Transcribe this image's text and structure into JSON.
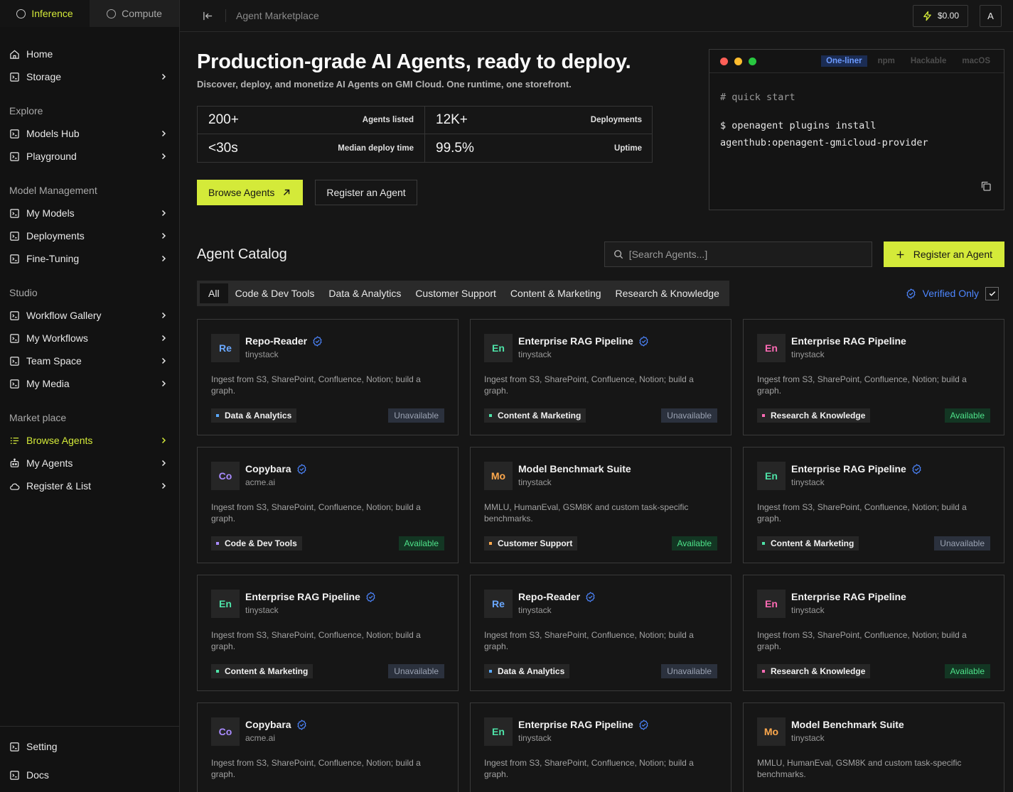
{
  "sidebar": {
    "mode_tabs": [
      {
        "label": "Inference",
        "active": true
      },
      {
        "label": "Compute",
        "active": false
      }
    ],
    "top_items": [
      {
        "label": "Home",
        "icon": "home-icon",
        "chevron": false
      },
      {
        "label": "Storage",
        "icon": "storage-icon",
        "chevron": true
      }
    ],
    "sections": [
      {
        "title": "Explore",
        "items": [
          {
            "label": "Models Hub",
            "icon": "models-hub-icon",
            "chevron": true
          },
          {
            "label": "Playground",
            "icon": "playground-icon",
            "chevron": true
          }
        ]
      },
      {
        "title": "Model Management",
        "items": [
          {
            "label": "My Models",
            "icon": "my-models-icon",
            "chevron": true
          },
          {
            "label": "Deployments",
            "icon": "deployments-icon",
            "chevron": true
          },
          {
            "label": "Fine-Tuning",
            "icon": "fine-tuning-icon",
            "chevron": true
          }
        ]
      },
      {
        "title": "Studio",
        "items": [
          {
            "label": "Workflow Gallery",
            "icon": "workflow-gallery-icon",
            "chevron": true
          },
          {
            "label": "My Workflows",
            "icon": "my-workflows-icon",
            "chevron": true
          },
          {
            "label": "Team Space",
            "icon": "team-space-icon",
            "chevron": true
          },
          {
            "label": "My Media",
            "icon": "my-media-icon",
            "chevron": true
          }
        ]
      },
      {
        "title": "Market place",
        "items": [
          {
            "label": "Browse Agents",
            "icon": "browse-agents-icon",
            "chevron": true,
            "active": true
          },
          {
            "label": "My Agents",
            "icon": "robot-icon",
            "chevron": true
          },
          {
            "label": "Register & List",
            "icon": "cloud-icon",
            "chevron": true
          }
        ]
      }
    ],
    "bottom_items": [
      {
        "label": "Setting",
        "icon": "setting-icon"
      },
      {
        "label": "Docs",
        "icon": "docs-icon"
      }
    ]
  },
  "topbar": {
    "breadcrumb": "Agent Marketplace",
    "balance": "$0.00",
    "avatar": "A"
  },
  "hero": {
    "title": "Production-grade AI Agents, ready to deploy.",
    "subtitle": "Discover, deploy, and monetize AI Agents on GMI Cloud. One runtime, one storefront.",
    "stats": [
      {
        "value": "200+",
        "label": "Agents listed"
      },
      {
        "value": "12K+",
        "label": "Deployments"
      },
      {
        "value": "<30s",
        "label": "Median deploy time"
      },
      {
        "value": "99.5%",
        "label": "Uptime"
      }
    ],
    "browse_label": "Browse Agents",
    "register_label": "Register an Agent"
  },
  "terminal": {
    "tabs": [
      {
        "label": "One-liner",
        "active": true
      },
      {
        "label": "npm",
        "active": false
      },
      {
        "label": "Hackable",
        "active": false
      },
      {
        "label": "macOS",
        "active": false
      }
    ],
    "comment": "# quick start",
    "command_line1": "$ openagent plugins install",
    "command_line2": "agenthub:openagent-gmicloud-provider",
    "dot_colors": [
      "#ff5f57",
      "#febc2e",
      "#28c840"
    ]
  },
  "catalog": {
    "title": "Agent Catalog",
    "search_placeholder": "[Search Agents...]",
    "register_label": "Register an Agent",
    "filters": [
      {
        "label": "All",
        "active": true
      },
      {
        "label": "Code & Dev Tools",
        "active": false
      },
      {
        "label": "Data & Analytics",
        "active": false
      },
      {
        "label": "Customer Support",
        "active": false
      },
      {
        "label": "Content & Marketing",
        "active": false
      },
      {
        "label": "Research & Knowledge",
        "active": false
      }
    ],
    "verified_label": "Verified Only",
    "verified_checked": true,
    "cards": [
      {
        "abbr": "Re",
        "abbr_color": "#6aa8ff",
        "name": "Repo-Reader",
        "verified": true,
        "org": "tinystack",
        "desc": "Ingest from S3, SharePoint, Confluence, Notion; build a graph.",
        "tag": "Data & Analytics",
        "tag_color": "#5aa9ff",
        "status": "Unavailable"
      },
      {
        "abbr": "En",
        "abbr_color": "#4ee3a8",
        "name": "Enterprise RAG Pipeline",
        "verified": true,
        "org": "tinystack",
        "desc": "Ingest from S3, SharePoint, Confluence, Notion; build a graph.",
        "tag": "Content & Marketing",
        "tag_color": "#4ee3a8",
        "status": "Unavailable"
      },
      {
        "abbr": "En",
        "abbr_color": "#ff6bb5",
        "name": "Enterprise RAG Pipeline",
        "verified": false,
        "org": "tinystack",
        "desc": "Ingest from S3, SharePoint, Confluence, Notion; build a graph.",
        "tag": "Research & Knowledge",
        "tag_color": "#ff6bb5",
        "status": "Available"
      },
      {
        "abbr": "Co",
        "abbr_color": "#a98bff",
        "name": "Copybara",
        "verified": true,
        "org": "acme.ai",
        "desc": "Ingest from S3, SharePoint, Confluence, Notion; build a graph.",
        "tag": "Code & Dev Tools",
        "tag_color": "#a98bff",
        "status": "Available"
      },
      {
        "abbr": "Mo",
        "abbr_color": "#ffa94d",
        "name": "Model Benchmark Suite",
        "verified": false,
        "org": "tinystack",
        "desc": "MMLU, HumanEval, GSM8K and custom task-specific benchmarks.",
        "tag": "Customer Support",
        "tag_color": "#ffa94d",
        "status": "Available"
      },
      {
        "abbr": "En",
        "abbr_color": "#4ee3a8",
        "name": "Enterprise RAG Pipeline",
        "verified": true,
        "org": "tinystack",
        "desc": "Ingest from S3, SharePoint, Confluence, Notion; build a graph.",
        "tag": "Content & Marketing",
        "tag_color": "#4ee3a8",
        "status": "Unavailable"
      },
      {
        "abbr": "En",
        "abbr_color": "#4ee3a8",
        "name": "Enterprise RAG Pipeline",
        "verified": true,
        "org": "tinystack",
        "desc": "Ingest from S3, SharePoint, Confluence, Notion; build a graph.",
        "tag": "Content & Marketing",
        "tag_color": "#4ee3a8",
        "status": "Unavailable"
      },
      {
        "abbr": "Re",
        "abbr_color": "#6aa8ff",
        "name": "Repo-Reader",
        "verified": true,
        "org": "tinystack",
        "desc": "Ingest from S3, SharePoint, Confluence, Notion; build a graph.",
        "tag": "Data & Analytics",
        "tag_color": "#5aa9ff",
        "status": "Unavailable"
      },
      {
        "abbr": "En",
        "abbr_color": "#ff6bb5",
        "name": "Enterprise RAG Pipeline",
        "verified": false,
        "org": "tinystack",
        "desc": "Ingest from S3, SharePoint, Confluence, Notion; build a graph.",
        "tag": "Research & Knowledge",
        "tag_color": "#ff6bb5",
        "status": "Available"
      },
      {
        "abbr": "Co",
        "abbr_color": "#a98bff",
        "name": "Copybara",
        "verified": true,
        "org": "acme.ai",
        "desc": "Ingest from S3, SharePoint, Confluence, Notion; build a graph.",
        "tag": "",
        "tag_color": "#a98bff",
        "status": ""
      },
      {
        "abbr": "En",
        "abbr_color": "#4ee3a8",
        "name": "Enterprise RAG Pipeline",
        "verified": true,
        "org": "tinystack",
        "desc": "Ingest from S3, SharePoint, Confluence, Notion; build a graph.",
        "tag": "",
        "tag_color": "#4ee3a8",
        "status": ""
      },
      {
        "abbr": "Mo",
        "abbr_color": "#ffa94d",
        "name": "Model Benchmark Suite",
        "verified": false,
        "org": "tinystack",
        "desc": "MMLU, HumanEval, GSM8K and custom task-specific benchmarks.",
        "tag": "",
        "tag_color": "#ffa94d",
        "status": ""
      }
    ]
  },
  "colors": {
    "accent": "#d4ea39",
    "verified_blue": "#4d86ff",
    "available_text": "#4ee38a",
    "unavailable_text": "#9aa2b2"
  }
}
